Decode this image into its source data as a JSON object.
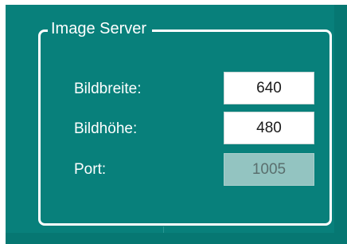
{
  "group": {
    "title": "Image Server"
  },
  "fields": [
    {
      "label": "Bildbreite:",
      "value": "640",
      "editable": true
    },
    {
      "label": "Bildhöhe:",
      "value": "480",
      "editable": true
    },
    {
      "label": "Port:",
      "value": "1005",
      "editable": false
    }
  ],
  "colors": {
    "background": "#08807b",
    "border": "#ffffff",
    "label_text": "#ffffff",
    "input_background": "#ffffff",
    "input_text": "#1b1b1b",
    "readonly_background": "#93c4c1",
    "readonly_text": "#5a6f6e"
  }
}
